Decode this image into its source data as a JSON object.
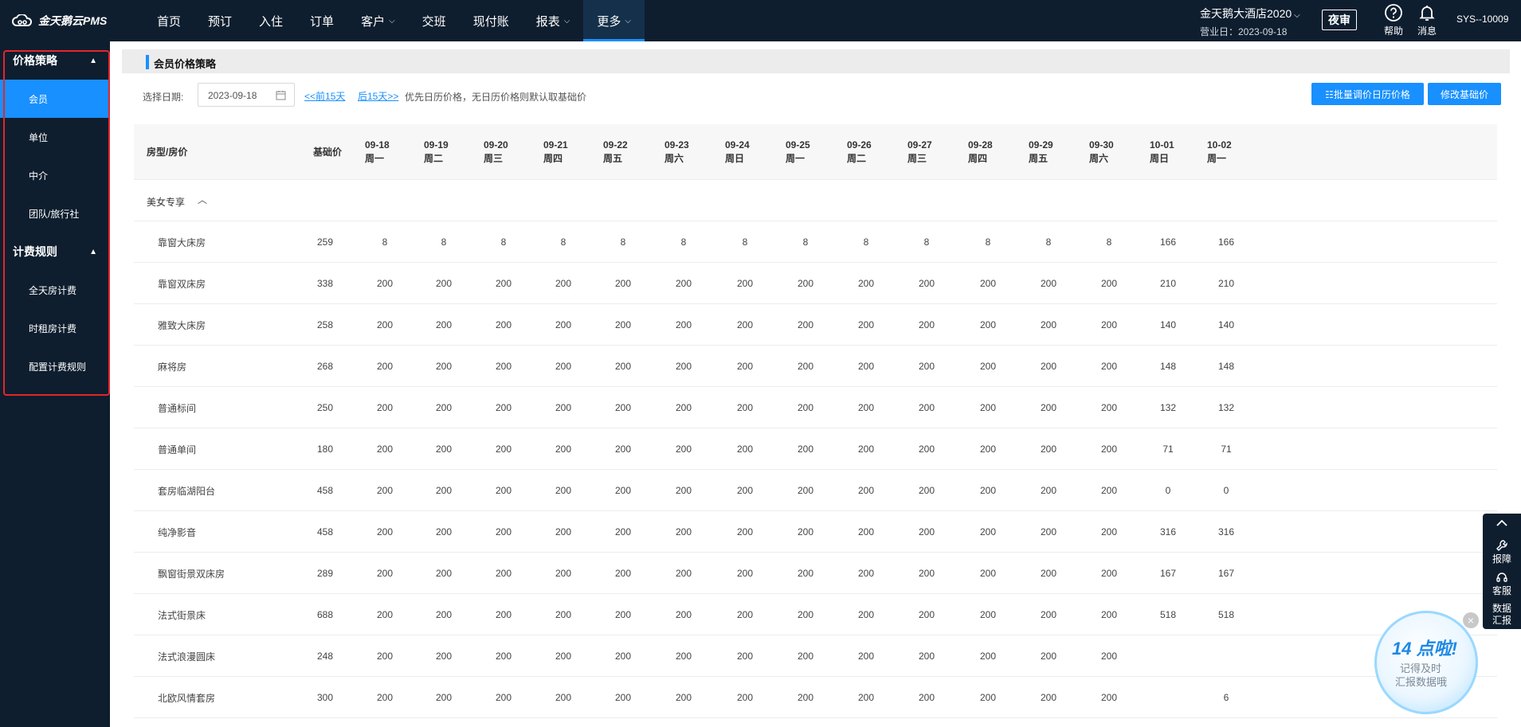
{
  "app": {
    "logo_text": "金天鹅云PMS",
    "nav": [
      {
        "label": "首页",
        "dropdown": false
      },
      {
        "label": "预订",
        "dropdown": false
      },
      {
        "label": "入住",
        "dropdown": false
      },
      {
        "label": "订单",
        "dropdown": false
      },
      {
        "label": "客户",
        "dropdown": true
      },
      {
        "label": "交班",
        "dropdown": false
      },
      {
        "label": "现付账",
        "dropdown": false
      },
      {
        "label": "报表",
        "dropdown": true
      },
      {
        "label": "更多",
        "dropdown": true,
        "active": true
      }
    ],
    "hotel_name": "金天鹅大酒店2020",
    "business_date": "营业日：2023-09-18",
    "night_audit_label": "夜审",
    "help_label": "帮助",
    "message_label": "消息",
    "user": "SYS--10009"
  },
  "sidebar": {
    "groups": [
      {
        "title": "价格策略",
        "items": [
          {
            "label": "会员",
            "active": true
          },
          {
            "label": "单位"
          },
          {
            "label": "中介"
          },
          {
            "label": "团队/旅行社"
          }
        ]
      },
      {
        "title": "计费规则",
        "items": [
          {
            "label": "全天房计费"
          },
          {
            "label": "时租房计费"
          },
          {
            "label": "配置计费规则"
          }
        ]
      }
    ]
  },
  "page": {
    "title": "会员价格策略",
    "date_label": "选择日期:",
    "date_value": "2023-09-18",
    "prev_link": "<<前15天",
    "next_link": "后15天>>",
    "hint": "优先日历价格，无日历价格则默认取基础价",
    "batch_button": "☷批量调价日历价格",
    "base_button": "修改基础价"
  },
  "table": {
    "header_room": "房型/房价",
    "header_base": "基础价",
    "dates": [
      {
        "date": "09-18",
        "weekday": "周一"
      },
      {
        "date": "09-19",
        "weekday": "周二"
      },
      {
        "date": "09-20",
        "weekday": "周三"
      },
      {
        "date": "09-21",
        "weekday": "周四"
      },
      {
        "date": "09-22",
        "weekday": "周五"
      },
      {
        "date": "09-23",
        "weekday": "周六"
      },
      {
        "date": "09-24",
        "weekday": "周日"
      },
      {
        "date": "09-25",
        "weekday": "周一"
      },
      {
        "date": "09-26",
        "weekday": "周二"
      },
      {
        "date": "09-27",
        "weekday": "周三"
      },
      {
        "date": "09-28",
        "weekday": "周四"
      },
      {
        "date": "09-29",
        "weekday": "周五"
      },
      {
        "date": "09-30",
        "weekday": "周六"
      },
      {
        "date": "10-01",
        "weekday": "周日"
      },
      {
        "date": "10-02",
        "weekday": "周一"
      }
    ],
    "group_name": "美女专享",
    "rows": [
      {
        "name": "靠窗大床房",
        "base": "259",
        "prices": [
          "8",
          "8",
          "8",
          "8",
          "8",
          "8",
          "8",
          "8",
          "8",
          "8",
          "8",
          "8",
          "8",
          "166",
          "166"
        ]
      },
      {
        "name": "靠窗双床房",
        "base": "338",
        "prices": [
          "200",
          "200",
          "200",
          "200",
          "200",
          "200",
          "200",
          "200",
          "200",
          "200",
          "200",
          "200",
          "200",
          "210",
          "210"
        ]
      },
      {
        "name": "雅致大床房",
        "base": "258",
        "prices": [
          "200",
          "200",
          "200",
          "200",
          "200",
          "200",
          "200",
          "200",
          "200",
          "200",
          "200",
          "200",
          "200",
          "140",
          "140"
        ]
      },
      {
        "name": "麻将房",
        "base": "268",
        "prices": [
          "200",
          "200",
          "200",
          "200",
          "200",
          "200",
          "200",
          "200",
          "200",
          "200",
          "200",
          "200",
          "200",
          "148",
          "148"
        ]
      },
      {
        "name": "普通标间",
        "base": "250",
        "prices": [
          "200",
          "200",
          "200",
          "200",
          "200",
          "200",
          "200",
          "200",
          "200",
          "200",
          "200",
          "200",
          "200",
          "132",
          "132"
        ]
      },
      {
        "name": "普通单间",
        "base": "180",
        "prices": [
          "200",
          "200",
          "200",
          "200",
          "200",
          "200",
          "200",
          "200",
          "200",
          "200",
          "200",
          "200",
          "200",
          "71",
          "71"
        ]
      },
      {
        "name": "套房临湖阳台",
        "base": "458",
        "prices": [
          "200",
          "200",
          "200",
          "200",
          "200",
          "200",
          "200",
          "200",
          "200",
          "200",
          "200",
          "200",
          "200",
          "0",
          "0"
        ]
      },
      {
        "name": "纯净影音",
        "base": "458",
        "prices": [
          "200",
          "200",
          "200",
          "200",
          "200",
          "200",
          "200",
          "200",
          "200",
          "200",
          "200",
          "200",
          "200",
          "316",
          "316"
        ]
      },
      {
        "name": "飘窗街景双床房",
        "base": "289",
        "prices": [
          "200",
          "200",
          "200",
          "200",
          "200",
          "200",
          "200",
          "200",
          "200",
          "200",
          "200",
          "200",
          "200",
          "167",
          "167"
        ]
      },
      {
        "name": "法式街景床",
        "base": "688",
        "prices": [
          "200",
          "200",
          "200",
          "200",
          "200",
          "200",
          "200",
          "200",
          "200",
          "200",
          "200",
          "200",
          "200",
          "518",
          "518"
        ]
      },
      {
        "name": "法式浪漫圆床",
        "base": "248",
        "prices": [
          "200",
          "200",
          "200",
          "200",
          "200",
          "200",
          "200",
          "200",
          "200",
          "200",
          "200",
          "200",
          "200",
          "",
          ""
        ]
      },
      {
        "name": "北欧风情套房",
        "base": "300",
        "prices": [
          "200",
          "200",
          "200",
          "200",
          "200",
          "200",
          "200",
          "200",
          "200",
          "200",
          "200",
          "200",
          "200",
          "",
          "6"
        ]
      }
    ]
  },
  "float_panel": {
    "report_label": "报障",
    "service_label": "客服",
    "data_label_1": "数据",
    "data_label_2": "汇报"
  },
  "reminder": {
    "title": "14 点啦!",
    "line1": "记得及时",
    "line2": "汇报数据哦"
  }
}
